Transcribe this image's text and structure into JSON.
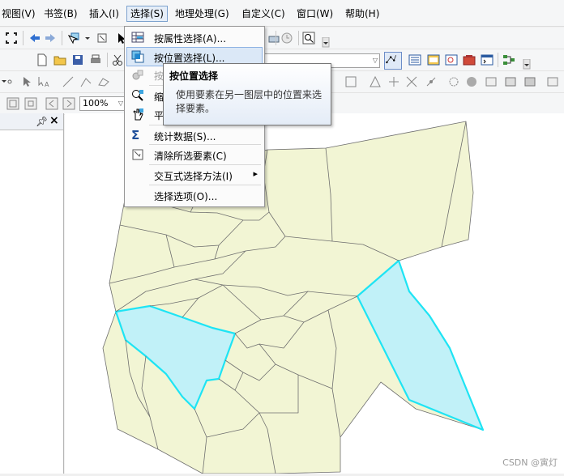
{
  "menubar": {
    "items": [
      {
        "label": "视图(V)"
      },
      {
        "label": "书签(B)"
      },
      {
        "label": "插入(I)"
      },
      {
        "label": "选择(S)"
      },
      {
        "label": "地理处理(G)"
      },
      {
        "label": "自定义(C)"
      },
      {
        "label": "窗口(W)"
      },
      {
        "label": "帮助(H)"
      }
    ]
  },
  "toolbar": {
    "zoom_value": "100%"
  },
  "select_menu": {
    "items": [
      {
        "label": "按属性选择(A)...",
        "icon": "attribute-table-icon"
      },
      {
        "label": "按位置选择(L)...",
        "icon": "select-by-location-icon"
      },
      {
        "label": "按",
        "icon": "select-by-graphics-icon"
      },
      {
        "label": "缩",
        "icon": "zoom-to-selected-icon"
      },
      {
        "label": "平",
        "icon": "pan-to-selected-icon"
      },
      {
        "label": "统计数据(S)...",
        "icon": "sigma-icon"
      },
      {
        "label": "清除所选要素(C)",
        "icon": "clear-selection-icon"
      },
      {
        "label": "交互式选择方法(I)",
        "icon": ""
      },
      {
        "label": "选择选项(O)...",
        "icon": ""
      }
    ],
    "submenu_arrow": "▸"
  },
  "tooltip": {
    "title": "按位置选择",
    "body": "使用要素在另一图层中的位置来选择要素。"
  },
  "toc": {
    "pin_icon": "pin-icon",
    "close_icon": "close-icon"
  },
  "map": {
    "fill_color": "#f2f5d4",
    "edge_color": "#6e6e6e",
    "selected_fill": "#c1f1f8",
    "selected_edge": "#1ee4f4"
  },
  "watermark": "CSDN @寅灯"
}
